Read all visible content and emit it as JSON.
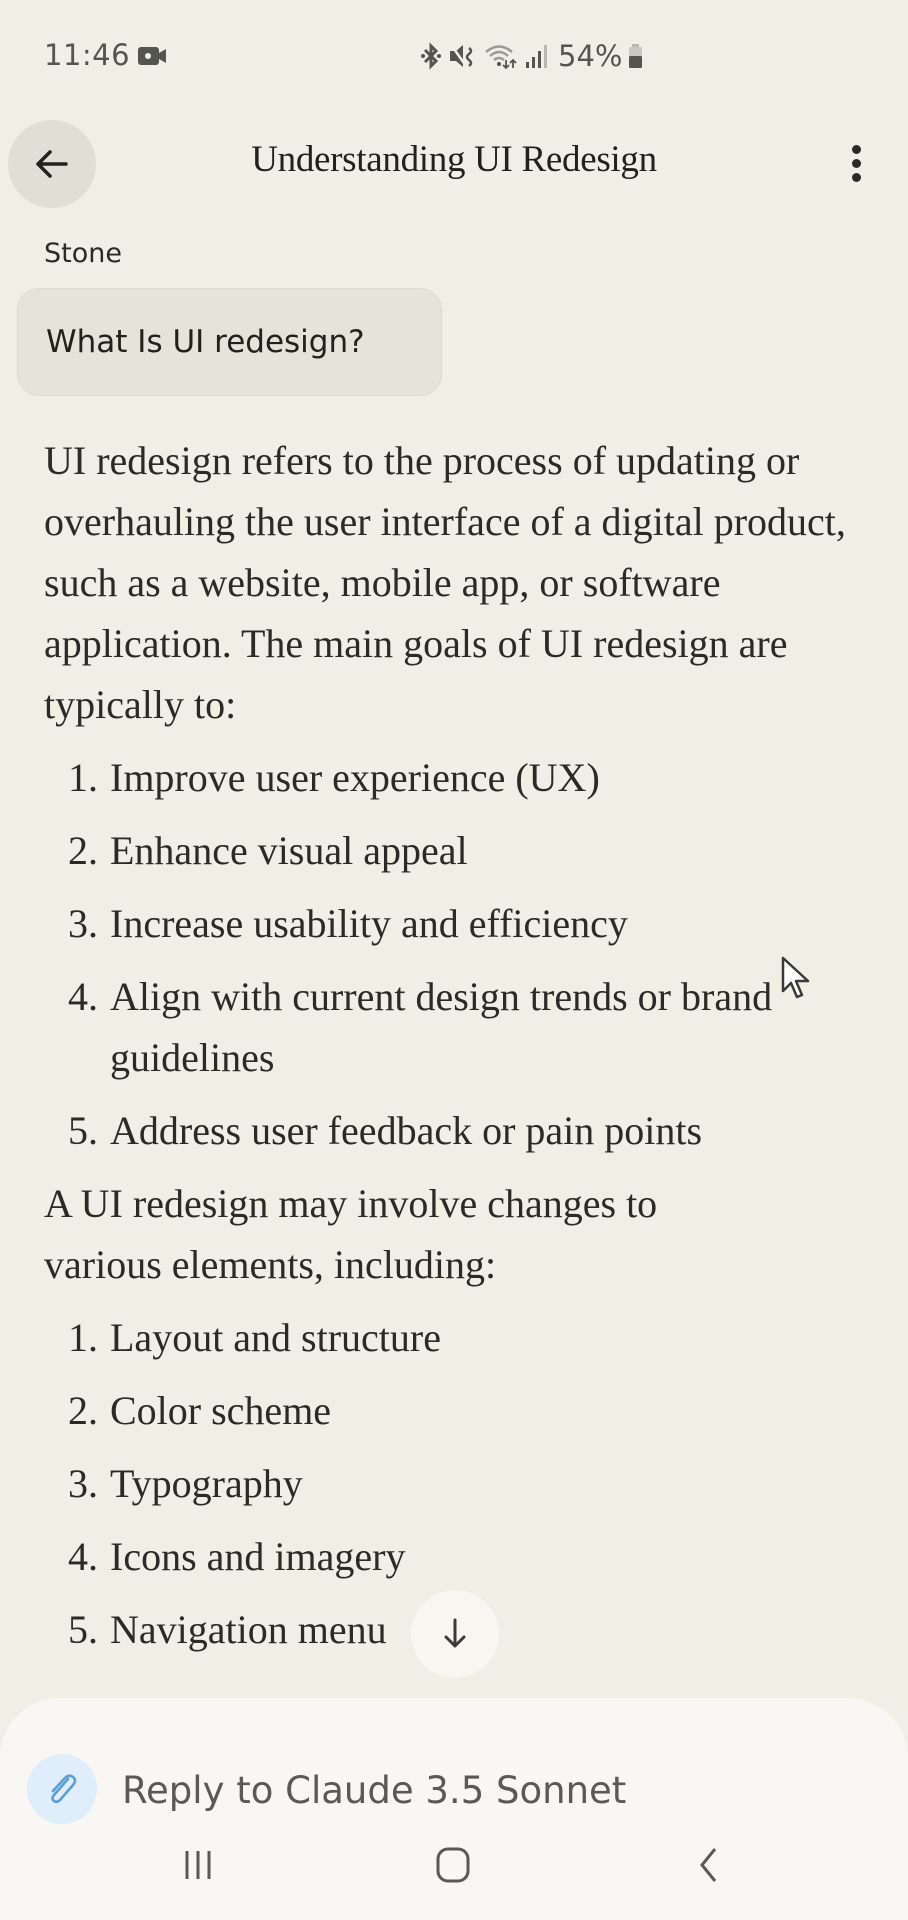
{
  "status_bar": {
    "time": "11:46",
    "battery_percent": "54%",
    "icons": [
      "video-record-icon",
      "bluetooth-icon",
      "mute-icon",
      "wifi-icon",
      "signal-icon",
      "battery-icon"
    ]
  },
  "header": {
    "title": "Understanding UI Redesign",
    "back_icon": "arrow-left-icon",
    "more_icon": "more-vertical-icon"
  },
  "conversation": {
    "user": {
      "name": "Stone",
      "message": "What Is UI redesign?"
    },
    "assistant": {
      "intro": "UI redesign refers to the process of updating or overhauling the user interface of a digital product, such as a website, mobile app, or software application. The main goals of UI redesign are typically to:",
      "goals": [
        {
          "num": "1.",
          "text": "Improve user experience (UX)"
        },
        {
          "num": "2.",
          "text": "Enhance visual appeal"
        },
        {
          "num": "3.",
          "text": "Increase usability and efficiency"
        },
        {
          "num": "4.",
          "text": "Align with current design trends or brand guidelines"
        },
        {
          "num": "5.",
          "text": "Address user feedback or pain points"
        }
      ],
      "elements_intro": "A UI redesign may involve changes to various elements, including:",
      "elements": [
        {
          "num": "1.",
          "text": "Layout and structure"
        },
        {
          "num": "2.",
          "text": "Color scheme"
        },
        {
          "num": "3.",
          "text": "Typography"
        },
        {
          "num": "4.",
          "text": "Icons and imagery"
        },
        {
          "num": "5.",
          "text": "Navigation menu"
        }
      ]
    }
  },
  "scroll_button": {
    "icon": "arrow-down-icon"
  },
  "composer": {
    "attach_icon": "paperclip-icon",
    "placeholder": "Reply to Claude 3.5 Sonnet",
    "value": ""
  },
  "nav_bar": {
    "recents_icon": "recents-icon",
    "home_icon": "home-icon",
    "back_icon": "back-chevron-icon"
  },
  "colors": {
    "background": "#f0efe6",
    "bubble": "#e5e4d9",
    "attach_accent": "#dfeefa",
    "attach_icon": "#5b9fd4",
    "text": "#2b2a25"
  }
}
